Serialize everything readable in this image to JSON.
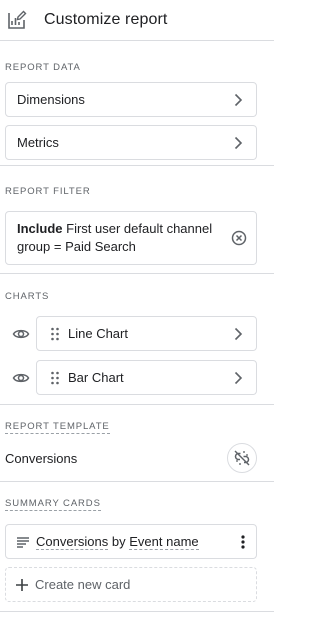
{
  "header": {
    "title": "Customize report",
    "icon": "report-edit-icon"
  },
  "report_data": {
    "label": "REPORT DATA",
    "items": [
      {
        "label": "Dimensions"
      },
      {
        "label": "Metrics"
      }
    ]
  },
  "report_filter": {
    "label": "REPORT FILTER",
    "keyword": "Include",
    "text": "First user default channel group = Paid Search"
  },
  "charts": {
    "label": "CHARTS",
    "items": [
      {
        "label": "Line Chart"
      },
      {
        "label": "Bar Chart"
      }
    ]
  },
  "report_template": {
    "label": "REPORT TEMPLATE",
    "value": "Conversions"
  },
  "summary_cards": {
    "label": "SUMMARY CARDS",
    "card": {
      "part1": "Conversions",
      "part2": "by",
      "part3": "Event name"
    },
    "create_label": "Create new card"
  },
  "colors": {
    "text": "#202124",
    "muted": "#5f6368",
    "border": "#dadce0"
  }
}
